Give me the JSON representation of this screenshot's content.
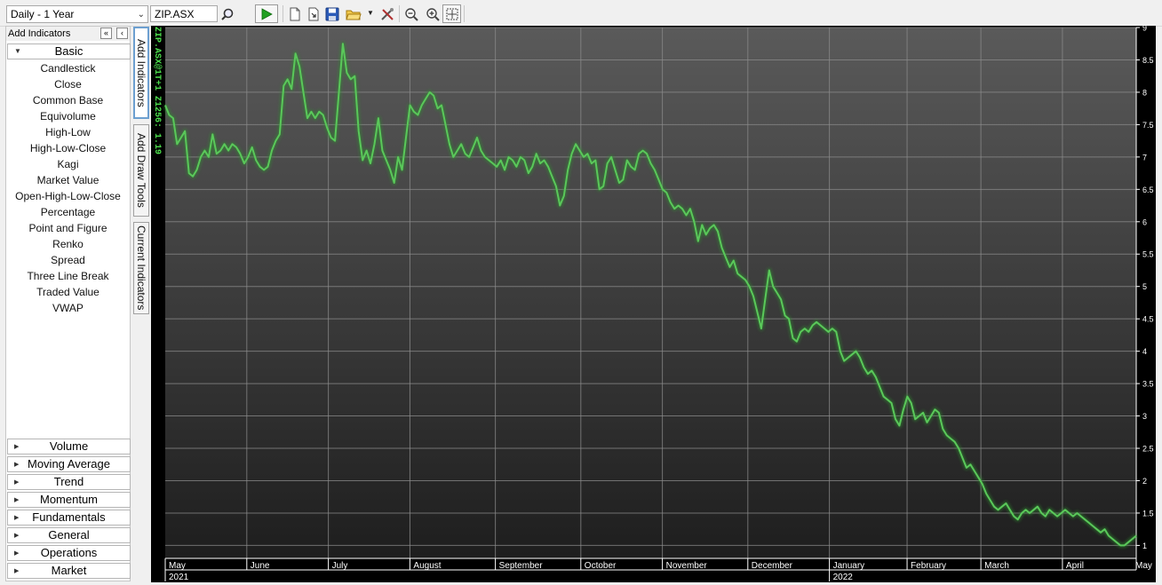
{
  "toolbar": {
    "period": "Daily - 1 Year",
    "symbol": "ZIP.ASX"
  },
  "left_panel": {
    "header": "Add Indicators",
    "collapse_all": "«",
    "collapse_panel": "‹",
    "active_category": "Basic",
    "basic_items": [
      "Candlestick",
      "Close",
      "Common Base",
      "Equivolume",
      "High-Low",
      "High-Low-Close",
      "Kagi",
      "Market Value",
      "Open-High-Low-Close",
      "Percentage",
      "Point and Figure",
      "Renko",
      "Spread",
      "Three Line Break",
      "Traded Value",
      "VWAP"
    ],
    "categories": [
      "Volume",
      "Moving Average",
      "Trend",
      "Momentum",
      "Fundamentals",
      "General",
      "Operations",
      "Market"
    ]
  },
  "side_tabs": [
    "Add Indicators",
    "Add Draw Tools",
    "Current Indicators"
  ],
  "chart_label": "ZIP.ASX@1T+1 Z1256: 1.19",
  "colors": {
    "line": "#5ac85a",
    "grid": "#8c8c8c",
    "axis_text": "#ffffff"
  },
  "chart_data": {
    "type": "line",
    "y_ticks": [
      "1",
      "1.5",
      "2",
      "2.5",
      "3",
      "3.5",
      "4",
      "4.5",
      "5",
      "5.5",
      "6",
      "6.5",
      "7",
      "7.5",
      "8",
      "8.5",
      "9"
    ],
    "ylim": [
      0.8,
      9.0
    ],
    "x_months": [
      "May",
      "June",
      "July",
      "August",
      "September",
      "October",
      "November",
      "December",
      "January",
      "February",
      "March",
      "April",
      "May"
    ],
    "x_years": [
      "2021",
      "2022"
    ],
    "x_index_range": [
      0,
      250
    ],
    "month_start_index": [
      0,
      21,
      42,
      63,
      85,
      107,
      128,
      150,
      171,
      191,
      210,
      231,
      250
    ],
    "series": [
      {
        "values": [
          7.8,
          7.65,
          7.6,
          7.2,
          7.3,
          7.4,
          6.75,
          6.7,
          6.8,
          7.0,
          7.1,
          7.0,
          7.35,
          7.05,
          7.1,
          7.2,
          7.1,
          7.2,
          7.15,
          7.05,
          6.9,
          7.0,
          7.15,
          6.95,
          6.85,
          6.8,
          6.85,
          7.1,
          7.25,
          7.35,
          8.1,
          8.2,
          8.05,
          8.6,
          8.4,
          8.0,
          7.6,
          7.7,
          7.6,
          7.7,
          7.65,
          7.45,
          7.3,
          7.25,
          8.0,
          8.75,
          8.3,
          8.2,
          8.25,
          7.4,
          6.95,
          7.1,
          6.9,
          7.2,
          7.6,
          7.1,
          6.95,
          6.8,
          6.6,
          7.0,
          6.8,
          7.3,
          7.8,
          7.7,
          7.65,
          7.8,
          7.9,
          8.0,
          7.95,
          7.75,
          7.8,
          7.5,
          7.2,
          7.0,
          7.1,
          7.2,
          7.05,
          7.0,
          7.15,
          7.3,
          7.1,
          7.0,
          6.95,
          6.9,
          6.85,
          6.95,
          6.8,
          7.0,
          6.95,
          6.85,
          7.0,
          6.95,
          6.75,
          6.85,
          7.05,
          6.9,
          6.95,
          6.85,
          6.7,
          6.55,
          6.25,
          6.4,
          6.8,
          7.05,
          7.2,
          7.1,
          7.0,
          7.05,
          6.9,
          6.95,
          6.5,
          6.55,
          6.9,
          7.0,
          6.8,
          6.6,
          6.65,
          6.95,
          6.85,
          6.8,
          7.05,
          7.1,
          7.05,
          6.9,
          6.8,
          6.65,
          6.5,
          6.45,
          6.3,
          6.2,
          6.25,
          6.2,
          6.1,
          6.2,
          6.0,
          5.7,
          5.95,
          5.8,
          5.9,
          5.95,
          5.85,
          5.6,
          5.45,
          5.3,
          5.4,
          5.2,
          5.15,
          5.1,
          5.0,
          4.85,
          4.6,
          4.35,
          4.8,
          5.25,
          5.0,
          4.9,
          4.8,
          4.55,
          4.5,
          4.2,
          4.15,
          4.3,
          4.35,
          4.3,
          4.4,
          4.45,
          4.4,
          4.35,
          4.3,
          4.35,
          4.3,
          4.0,
          3.85,
          3.9,
          3.95,
          4.0,
          3.9,
          3.75,
          3.65,
          3.7,
          3.6,
          3.45,
          3.3,
          3.25,
          3.2,
          2.95,
          2.85,
          3.1,
          3.3,
          3.2,
          2.95,
          3.0,
          3.05,
          2.9,
          3.0,
          3.1,
          3.05,
          2.8,
          2.7,
          2.65,
          2.6,
          2.5,
          2.35,
          2.2,
          2.25,
          2.15,
          2.05,
          1.95,
          1.8,
          1.7,
          1.6,
          1.55,
          1.6,
          1.65,
          1.55,
          1.45,
          1.4,
          1.5,
          1.55,
          1.5,
          1.55,
          1.6,
          1.5,
          1.45,
          1.55,
          1.5,
          1.45,
          1.5,
          1.55,
          1.5,
          1.45,
          1.5,
          1.45,
          1.4,
          1.35,
          1.3,
          1.25,
          1.2,
          1.25,
          1.15,
          1.1,
          1.05,
          1.0,
          1.0,
          1.05,
          1.1,
          1.15
        ]
      }
    ]
  }
}
